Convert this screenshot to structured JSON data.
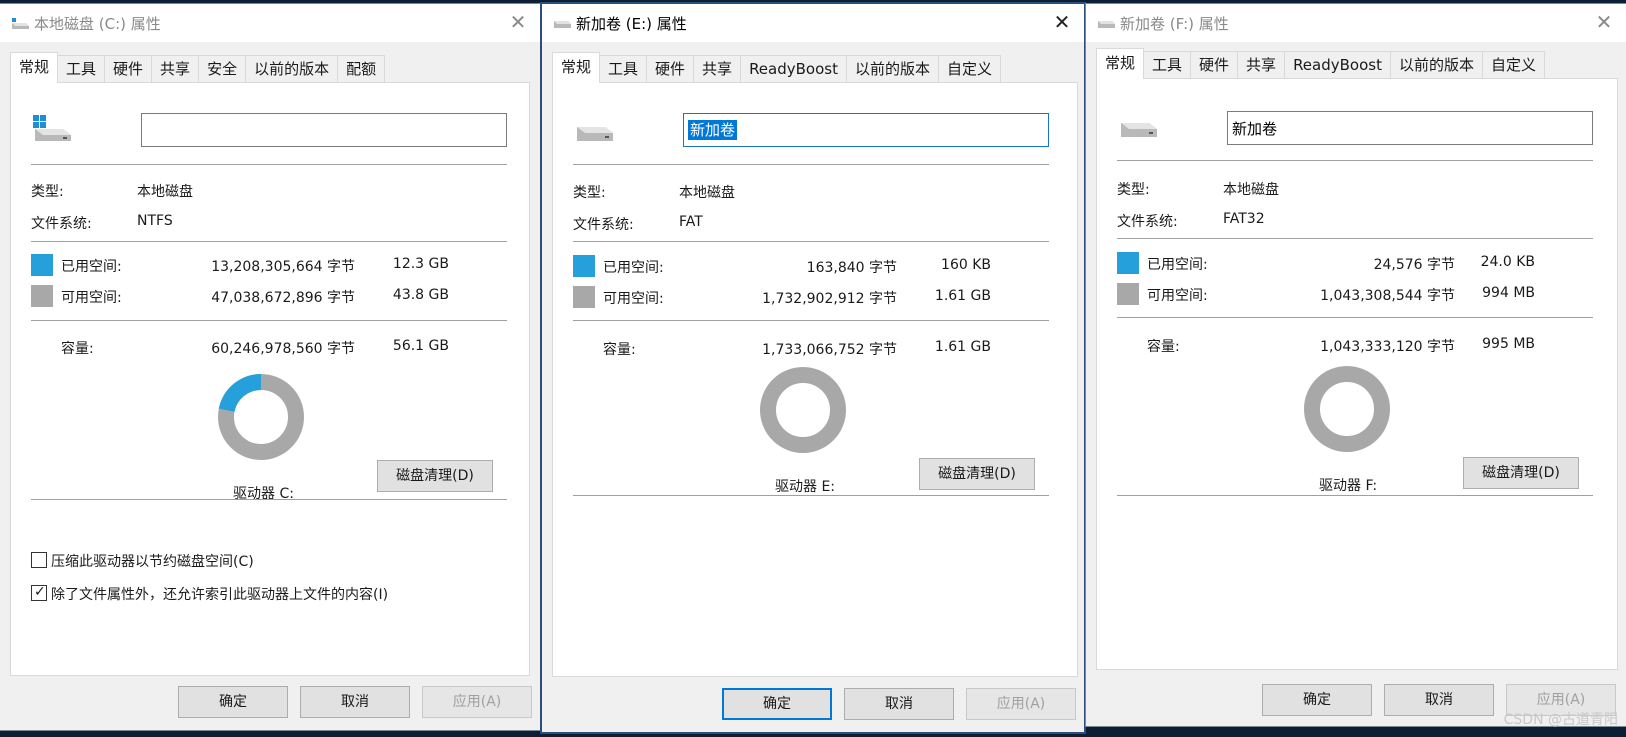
{
  "windows": [
    {
      "title": "本地磁盘 (C:) 属性",
      "tabs": [
        "常规",
        "工具",
        "硬件",
        "共享",
        "安全",
        "以前的版本",
        "配额"
      ],
      "active_tab": "常规",
      "volume_name": "",
      "type_label": "类型:",
      "type_value": "本地磁盘",
      "fs_label": "文件系统:",
      "fs_value": "NTFS",
      "used_label": "已用空间:",
      "used_bytes": "13,208,305,664 字节",
      "used_size": "12.3 GB",
      "free_label": "可用空间:",
      "free_bytes": "47,038,672,896 字节",
      "free_size": "43.8 GB",
      "cap_label": "容量:",
      "cap_bytes": "60,246,978,560 字节",
      "cap_size": "56.1 GB",
      "used_fraction": 0.219,
      "drive_label": "驱动器 C:",
      "cleanup_button": "磁盘清理(D)",
      "compress_label": "压缩此驱动器以节约磁盘空间(C)",
      "compress_checked": false,
      "index_label": "除了文件属性外，还允许索引此驱动器上文件的内容(I)",
      "index_checked": true,
      "ok_button": "确定",
      "cancel_button": "取消",
      "apply_button": "应用(A)"
    },
    {
      "title": "新加卷 (E:) 属性",
      "tabs": [
        "常规",
        "工具",
        "硬件",
        "共享",
        "ReadyBoost",
        "以前的版本",
        "自定义"
      ],
      "active_tab": "常规",
      "volume_name": "新加卷",
      "type_label": "类型:",
      "type_value": "本地磁盘",
      "fs_label": "文件系统:",
      "fs_value": "FAT",
      "used_label": "已用空间:",
      "used_bytes": "163,840 字节",
      "used_size": "160 KB",
      "free_label": "可用空间:",
      "free_bytes": "1,732,902,912 字节",
      "free_size": "1.61 GB",
      "cap_label": "容量:",
      "cap_bytes": "1,733,066,752 字节",
      "cap_size": "1.61 GB",
      "used_fraction": 0.0001,
      "drive_label": "驱动器 E:",
      "cleanup_button": "磁盘清理(D)",
      "ok_button": "确定",
      "cancel_button": "取消",
      "apply_button": "应用(A)"
    },
    {
      "title": "新加卷 (F:) 属性",
      "tabs": [
        "常规",
        "工具",
        "硬件",
        "共享",
        "ReadyBoost",
        "以前的版本",
        "自定义"
      ],
      "active_tab": "常规",
      "volume_name": "新加卷",
      "type_label": "类型:",
      "type_value": "本地磁盘",
      "fs_label": "文件系统:",
      "fs_value": "FAT32",
      "used_label": "已用空间:",
      "used_bytes": "24,576 字节",
      "used_size": "24.0 KB",
      "free_label": "可用空间:",
      "free_bytes": "1,043,308,544 字节",
      "free_size": "994 MB",
      "cap_label": "容量:",
      "cap_bytes": "1,043,333,120 字节",
      "cap_size": "995 MB",
      "used_fraction": 2e-05,
      "drive_label": "驱动器 F:",
      "cleanup_button": "磁盘清理(D)",
      "ok_button": "确定",
      "cancel_button": "取消",
      "apply_button": "应用(A)"
    }
  ],
  "colors": {
    "used": "#26a0da",
    "free": "#a8a8a8",
    "accent": "#0078d7"
  },
  "watermark": "CSDN @古道青阳"
}
